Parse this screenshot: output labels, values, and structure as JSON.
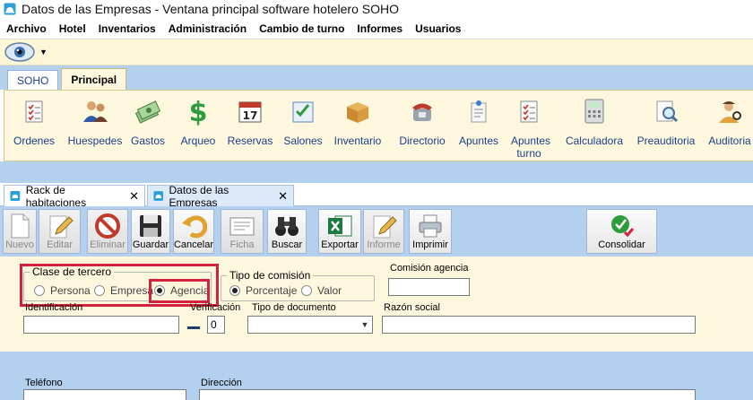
{
  "window": {
    "title": "Datos de las Empresas - Ventana principal software hotelero SOHO"
  },
  "menu": [
    "Archivo",
    "Hotel",
    "Inventarios",
    "Administración",
    "Cambio de turno",
    "Informes",
    "Usuarios"
  ],
  "ribbon_tabs": [
    "SOHO",
    "Principal"
  ],
  "ribbon_buttons": [
    {
      "label": "Ordenes",
      "icon": "clipboard-checklist-icon"
    },
    {
      "label": "Huespedes",
      "icon": "guests-icon"
    },
    {
      "label": "Gastos",
      "icon": "money-stack-icon"
    },
    {
      "label": "Arqueo",
      "icon": "dollar-sign-icon"
    },
    {
      "label": "Reservas",
      "icon": "calendar-17-icon"
    },
    {
      "label": "Salones",
      "icon": "checkbox-list-icon"
    },
    {
      "label": "Inventario",
      "icon": "cardboard-box-icon"
    },
    {
      "label": "Directorio",
      "icon": "telephone-icon"
    },
    {
      "label": "Apuntes",
      "icon": "notepad-pin-icon"
    },
    {
      "label": "Apuntes turno",
      "icon": "clipboard-checklist-icon"
    },
    {
      "label": "Calculadora",
      "icon": "calculator-icon"
    },
    {
      "label": "Preauditoria",
      "icon": "magnifier-document-icon"
    },
    {
      "label": "Auditoria",
      "icon": "auditor-icon"
    }
  ],
  "doc_tabs": [
    {
      "label": "Rack de habitaciones",
      "close": "✕"
    },
    {
      "label": "Datos de las Empresas",
      "close": "✕"
    }
  ],
  "toolbar": [
    {
      "label": "Nuevo",
      "icon": "blank-page-icon",
      "enabled": false
    },
    {
      "label": "Editar",
      "icon": "pencil-edit-icon",
      "enabled": false
    },
    {
      "label": "Eliminar",
      "icon": "prohibited-icon",
      "enabled": false
    },
    {
      "label": "Guardar",
      "icon": "floppy-disk-icon",
      "enabled": true
    },
    {
      "label": "Cancelar",
      "icon": "undo-arrow-icon",
      "enabled": true
    },
    {
      "label": "Ficha",
      "icon": "card-file-icon",
      "enabled": false
    },
    {
      "label": "Buscar",
      "icon": "binoculars-icon",
      "enabled": true
    },
    {
      "label": "Exportar",
      "icon": "excel-icon",
      "enabled": true
    },
    {
      "label": "Informe",
      "icon": "report-pencil-icon",
      "enabled": false
    },
    {
      "label": "Imprimir",
      "icon": "printer-icon",
      "enabled": true
    },
    {
      "label": "Consolidar",
      "icon": "consolidate-check-icon",
      "enabled": true
    }
  ],
  "form": {
    "clase_tercero": {
      "legend": "Clase de tercero",
      "options": [
        {
          "label": "Persona",
          "checked": false
        },
        {
          "label": "Empresa",
          "checked": false
        },
        {
          "label": "Agencia",
          "checked": true
        }
      ]
    },
    "tipo_comision": {
      "legend": "Tipo de comisión",
      "options": [
        {
          "label": "Porcentaje",
          "checked": true
        },
        {
          "label": "Valor",
          "checked": false
        }
      ]
    },
    "comision_agencia": {
      "label": "Comisión agencia",
      "value": ""
    },
    "identificacion": {
      "label": "Identificación",
      "value": ""
    },
    "verificacion": {
      "label": "Verificación",
      "value": "0"
    },
    "tipo_documento": {
      "label": "Tipo de documento",
      "value": ""
    },
    "razon_social": {
      "label": "Razón social",
      "value": ""
    },
    "telefono": {
      "label": "Teléfono",
      "value": ""
    },
    "direccion": {
      "label": "Dirección",
      "value": ""
    }
  },
  "colors": {
    "highlight": "#d4213d",
    "ribbon_bg": "#fdf8dd",
    "band": "#b4d0ef"
  }
}
